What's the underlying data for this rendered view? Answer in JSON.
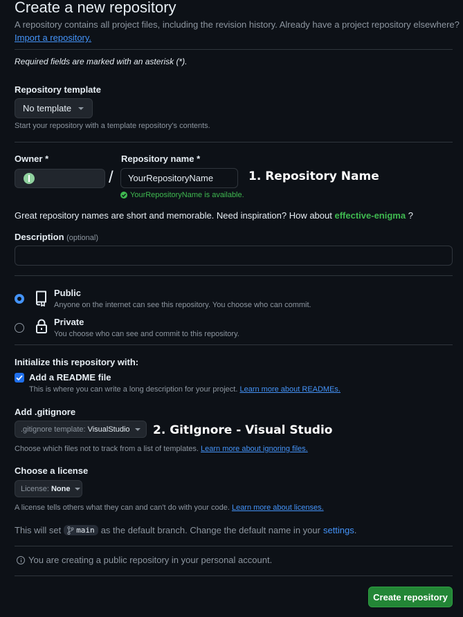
{
  "header": {
    "title": "Create a new repository",
    "subtitle": "A repository contains all project files, including the revision history. Already have a project repository elsewhere?",
    "import_link": "Import a repository."
  },
  "required_note": "Required fields are marked with an asterisk (*).",
  "template": {
    "label": "Repository template",
    "selected": "No template",
    "hint": "Start your repository with a template repository's contents."
  },
  "owner": {
    "label": "Owner *",
    "slash": "/"
  },
  "repo_name": {
    "label": "Repository name *",
    "value": "YourRepositoryName",
    "available": "YourRepositoryName is available."
  },
  "annotations": {
    "repo_name": "1. Repository Name",
    "gitignore": "2. GitIgnore - Visual Studio"
  },
  "suggestion": {
    "text": "Great repository names are short and memorable. Need inspiration? How about",
    "name": "effective-enigma",
    "end": "?"
  },
  "description": {
    "label": "Description",
    "optional": "(optional)",
    "value": ""
  },
  "visibility": {
    "public_label": "Public",
    "public_desc": "Anyone on the internet can see this repository. You choose who can commit.",
    "private_label": "Private",
    "private_desc": "You choose who can see and commit to this repository.",
    "selected": "public"
  },
  "init": {
    "heading": "Initialize this repository with:",
    "readme_label": "Add a README file",
    "readme_checked": true,
    "readme_desc": "This is where you can write a long description for your project.",
    "readme_link": "Learn more about READMEs."
  },
  "gitignore": {
    "label": "Add .gitignore",
    "prefix": ".gitignore template:",
    "value": "VisualStudio",
    "hint": "Choose which files not to track from a list of templates.",
    "hint_link": "Learn more about ignoring files."
  },
  "license": {
    "label": "Choose a license",
    "prefix": "License:",
    "value": "None",
    "hint": "A license tells others what they can and can't do with your code.",
    "hint_link": "Learn more about licenses."
  },
  "branch": {
    "before": "This will set",
    "name": "main",
    "after": "as the default branch. Change the default name in your",
    "settings_link": "settings",
    "end": "."
  },
  "notice": "You are creating a public repository in your personal account.",
  "submit": "Create repository",
  "colors": {
    "background": "#0d1117",
    "accent": "#4493f8",
    "success": "#3fb950",
    "button_green": "#238636",
    "border": "#30363d"
  }
}
